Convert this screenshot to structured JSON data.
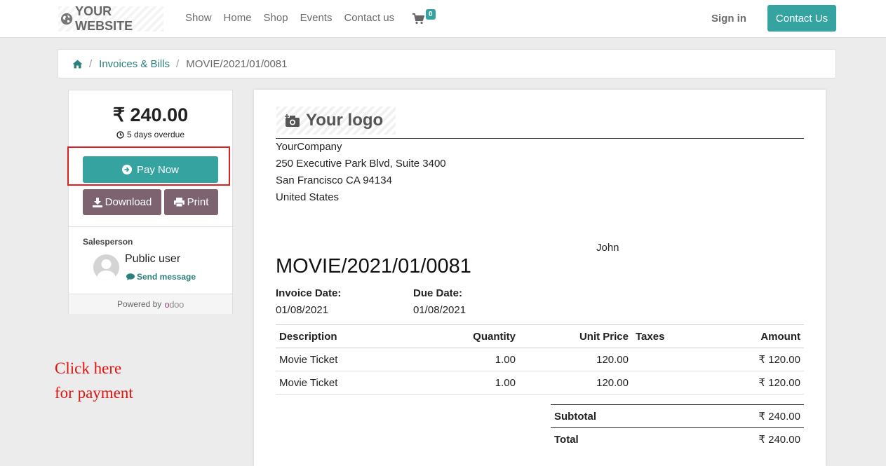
{
  "nav": {
    "brand": "YOUR WEBSITE",
    "links": [
      "Show",
      "Home",
      "Shop",
      "Events",
      "Contact us"
    ],
    "cart_count": "0",
    "sign_in": "Sign in",
    "contact_button": "Contact Us"
  },
  "breadcrumb": {
    "parent": "Invoices & Bills",
    "current": "MOVIE/2021/01/0081"
  },
  "sidebar": {
    "amount": "₹ 240.00",
    "overdue": "5 days overdue",
    "pay_now": "Pay Now",
    "download": "Download",
    "print": "Print",
    "salesperson_label": "Salesperson",
    "salesperson_name": "Public user",
    "send_message": "Send message",
    "powered_by": "Powered by"
  },
  "annotation": {
    "line1": "Click here",
    "line2": "for payment"
  },
  "invoice": {
    "logo_text": "Your logo",
    "company": {
      "name": "YourCompany",
      "street": "250 Executive Park Blvd, Suite 3400",
      "city": "San Francisco CA 94134",
      "country": "United States"
    },
    "customer": "John",
    "number": "MOVIE/2021/01/0081",
    "invoice_date_label": "Invoice Date:",
    "invoice_date": "01/08/2021",
    "due_date_label": "Due Date:",
    "due_date": "01/08/2021",
    "columns": {
      "description": "Description",
      "quantity": "Quantity",
      "unit_price": "Unit Price",
      "taxes": "Taxes",
      "amount": "Amount"
    },
    "lines": [
      {
        "description": "Movie Ticket",
        "quantity": "1.00",
        "unit_price": "120.00",
        "taxes": "",
        "amount": "₹ 120.00"
      },
      {
        "description": "Movie Ticket",
        "quantity": "1.00",
        "unit_price": "120.00",
        "taxes": "",
        "amount": "₹ 120.00"
      }
    ],
    "subtotal_label": "Subtotal",
    "subtotal": "₹ 240.00",
    "total_label": "Total",
    "total": "₹ 240.00"
  },
  "colors": {
    "primary": "#35a3a0",
    "secondary": "#7c636f",
    "annotation": "#e0140f",
    "link": "#2b7f7c"
  }
}
